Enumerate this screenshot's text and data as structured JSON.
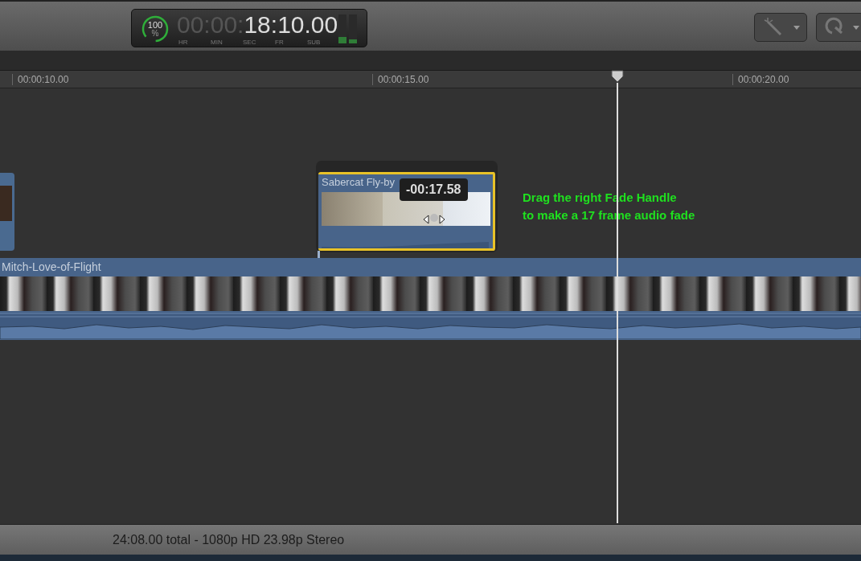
{
  "toolbar": {
    "skimmer_percent": "100",
    "percent_sign": "%",
    "timecode_dim": "00:00:",
    "timecode": "18:10.00",
    "timecode_labels": [
      "HR",
      "MIN",
      "SEC",
      "FR",
      "SUB"
    ]
  },
  "ruler": {
    "ticks": [
      "00:00:10.00",
      "00:00:15.00",
      "00:00:20.00"
    ]
  },
  "connected_clip": {
    "title": "Sabercat Fly-by",
    "tooltip": "-00:17.58",
    "selected": true
  },
  "primary_clip": {
    "title": "Mitch-Love-of-Flight"
  },
  "annotation": [
    "Drag the right Fade Handle",
    "to make a 17 frame audio fade"
  ],
  "status_bar": "24:08.00 total - 1080p HD 23.98p Stereo"
}
